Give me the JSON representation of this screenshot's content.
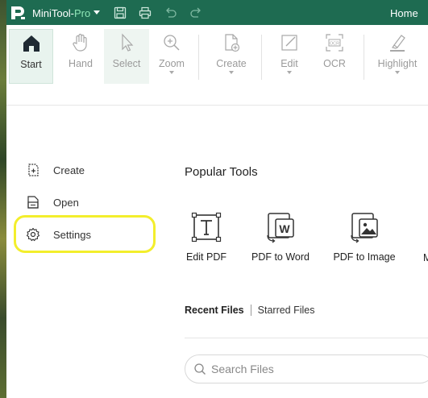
{
  "titlebar": {
    "app_name_prefix": "MiniTool-",
    "app_name_suffix": "Pro",
    "home_tab": "Home"
  },
  "ribbon": {
    "buttons": [
      {
        "label": "Start"
      },
      {
        "label": "Hand"
      },
      {
        "label": "Select"
      },
      {
        "label": "Zoom"
      },
      {
        "label": "Create"
      },
      {
        "label": "Edit"
      },
      {
        "label": "OCR"
      },
      {
        "label": "Highlight"
      }
    ]
  },
  "nav": {
    "items": [
      {
        "label": "Create"
      },
      {
        "label": "Open"
      },
      {
        "label": "Settings"
      }
    ]
  },
  "main": {
    "popular_title": "Popular Tools",
    "tools": [
      {
        "label": "Edit PDF"
      },
      {
        "label": "PDF to Word"
      },
      {
        "label": "PDF to Image"
      }
    ],
    "more_tool_label": "M",
    "tabs": {
      "recent": "Recent Files",
      "starred": "Starred Files"
    },
    "search_placeholder": "Search Files"
  },
  "colors": {
    "titlebar": "#1e6b51",
    "accent": "#1e6b51",
    "highlight_ring": "#f3ee2c"
  },
  "icons": {
    "logo": "minitool-logo-icon",
    "save": "save-icon",
    "print": "print-icon",
    "undo": "undo-icon",
    "redo": "redo-icon"
  }
}
